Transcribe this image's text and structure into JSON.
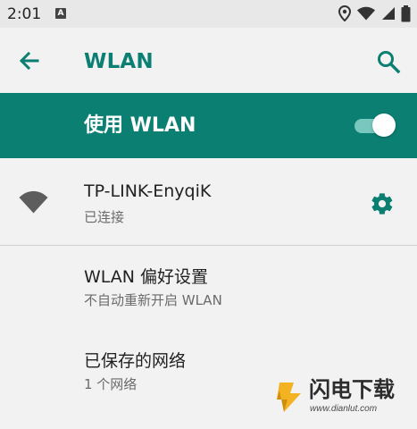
{
  "status_bar": {
    "time": "2:01",
    "notification_icon": "a-letter-icon",
    "icons": [
      "location-icon",
      "wifi-icon",
      "signal-icon",
      "battery-icon"
    ]
  },
  "app_bar": {
    "back_icon": "arrow-left-icon",
    "title": "WLAN",
    "search_icon": "search-icon"
  },
  "wlan_toggle": {
    "label": "使用 WLAN",
    "enabled": true
  },
  "network": {
    "ssid": "TP-LINK-EnyqiK",
    "status": "已连接",
    "signal_icon": "wifi-signal-icon",
    "settings_icon": "gear-icon"
  },
  "preferences": {
    "title": "WLAN 偏好设置",
    "subtitle": "不自动重新开启 WLAN"
  },
  "saved_networks": {
    "title": "已保存的网络",
    "subtitle": "1 个网络"
  },
  "watermark": {
    "brand": "闪电下载",
    "url": "www.dianlut.com"
  },
  "colors": {
    "accent": "#0c7f73",
    "background": "#f2f2f2",
    "status_bar": "#e8e8e8",
    "switch_track": "#78c8bf",
    "primary_text": "#212121",
    "secondary_text": "#6b6b6b"
  }
}
